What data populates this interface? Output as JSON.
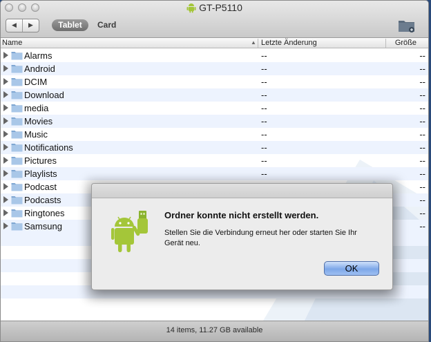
{
  "window": {
    "title": "GT-P5110"
  },
  "toolbar": {
    "back_icon": "◀",
    "forward_icon": "▶",
    "tab_tablet": "Tablet",
    "tab_card": "Card"
  },
  "columns": {
    "name": "Name",
    "date": "Letzte Änderung",
    "size": "Größe",
    "sort_icon": "▲"
  },
  "items": [
    {
      "name": "Alarms",
      "date": "--",
      "size": "--"
    },
    {
      "name": "Android",
      "date": "--",
      "size": "--"
    },
    {
      "name": "DCIM",
      "date": "--",
      "size": "--"
    },
    {
      "name": "Download",
      "date": "--",
      "size": "--"
    },
    {
      "name": "media",
      "date": "--",
      "size": "--"
    },
    {
      "name": "Movies",
      "date": "--",
      "size": "--"
    },
    {
      "name": "Music",
      "date": "--",
      "size": "--"
    },
    {
      "name": "Notifications",
      "date": "--",
      "size": "--"
    },
    {
      "name": "Pictures",
      "date": "--",
      "size": "--"
    },
    {
      "name": "Playlists",
      "date": "--",
      "size": "--"
    },
    {
      "name": "Podcast",
      "date": "--",
      "size": "--"
    },
    {
      "name": "Podcasts",
      "date": "--",
      "size": "--"
    },
    {
      "name": "Ringtones",
      "date": "--",
      "size": "--"
    },
    {
      "name": "Samsung",
      "date": "--",
      "size": "--"
    }
  ],
  "status": {
    "text": "14 items, 11.27 GB available"
  },
  "dialog": {
    "title": "Ordner konnte nicht erstellt werden.",
    "message": "Stellen Sie die Verbindung erneut her oder starten Sie Ihr Gerät neu.",
    "ok_label": "OK",
    "icon": "android-usb-icon"
  },
  "colors": {
    "accent": "#7da7e8",
    "android_green": "#a4c639",
    "folder_blue": "#8fb3da"
  }
}
